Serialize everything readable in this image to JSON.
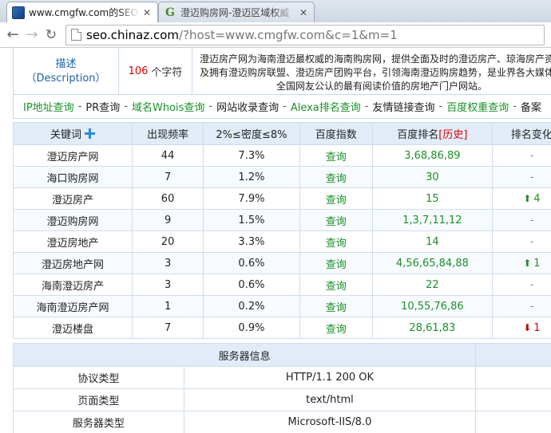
{
  "browser": {
    "tabs": [
      {
        "title": "www.cmgfw.com的SEO综",
        "active": true
      },
      {
        "title": "澄迈购房网-澄迈区域权威",
        "active": false
      }
    ],
    "url_host": "seo.chinaz.com",
    "url_rest": "/?host=www.cmgfw.com&c=1&m=1"
  },
  "description": {
    "label_line1": "描述",
    "label_line2": "（Description）",
    "count_num": "106",
    "count_unit": "个字符",
    "text": "澄迈房产网为海南澄迈最权威的海南购房网，提供全面及时的澄迈房产、琼海房产资料及拥有澄迈购房联盟、澄迈房产团购平台，引领海南澄迈购房趋势，是业界各大媒体及全国网友公认的最有阅读价值的房地产门户网站。"
  },
  "quicklinks": [
    {
      "label": "IP地址查询",
      "plain": false
    },
    {
      "label": "PR查询",
      "plain": true
    },
    {
      "label": "域名Whois查询",
      "plain": false
    },
    {
      "label": "网站收录查询",
      "plain": true
    },
    {
      "label": "Alexa排名查询",
      "plain": false
    },
    {
      "label": "友情链接查询",
      "plain": true
    },
    {
      "label": "百度权重查询",
      "plain": false
    },
    {
      "label": "备案",
      "plain": true
    }
  ],
  "keyword_table": {
    "headers": {
      "keyword": "关键词",
      "frequency": "出现频率",
      "density": "2%≤密度≤8%",
      "baidu_index": "百度指数",
      "baidu_rank": "百度排名",
      "history_link": "[历史]",
      "rank_change": "排名变化"
    },
    "rows": [
      {
        "keyword": "澄迈房产网",
        "frequency": "44",
        "density": "7.3%",
        "query": "查询",
        "ranks": "3,68,86,89",
        "change": "-",
        "dir": "none"
      },
      {
        "keyword": "海口购房网",
        "frequency": "7",
        "density": "1.2%",
        "query": "查询",
        "ranks": "30",
        "change": "-",
        "dir": "none"
      },
      {
        "keyword": "澄迈房产",
        "frequency": "60",
        "density": "7.9%",
        "query": "查询",
        "ranks": "15",
        "change": "4",
        "dir": "up"
      },
      {
        "keyword": "澄迈购房网",
        "frequency": "9",
        "density": "1.5%",
        "query": "查询",
        "ranks": "1,3,7,11,12",
        "change": "-",
        "dir": "none"
      },
      {
        "keyword": "澄迈房地产",
        "frequency": "20",
        "density": "3.3%",
        "query": "查询",
        "ranks": "14",
        "change": "-",
        "dir": "none"
      },
      {
        "keyword": "澄迈房地产网",
        "frequency": "3",
        "density": "0.6%",
        "query": "查询",
        "ranks": "4,56,65,84,88",
        "change": "1",
        "dir": "up"
      },
      {
        "keyword": "海南澄迈房产",
        "frequency": "3",
        "density": "0.6%",
        "query": "查询",
        "ranks": "22",
        "change": "-",
        "dir": "none"
      },
      {
        "keyword": "海南澄迈房产网",
        "frequency": "1",
        "density": "0.2%",
        "query": "查询",
        "ranks": "10,55,76,86",
        "change": "-",
        "dir": "none"
      },
      {
        "keyword": "澄迈楼盘",
        "frequency": "7",
        "density": "0.9%",
        "query": "查询",
        "ranks": "28,61,83",
        "change": "1",
        "dir": "down"
      }
    ]
  },
  "server_table": {
    "title": "服务器信息",
    "rows": [
      {
        "label": "协议类型",
        "value": "HTTP/1.1 200 OK"
      },
      {
        "label": "页面类型",
        "value": "text/html"
      },
      {
        "label": "服务器类型",
        "value": "Microsoft-IIS/8.0"
      }
    ]
  }
}
